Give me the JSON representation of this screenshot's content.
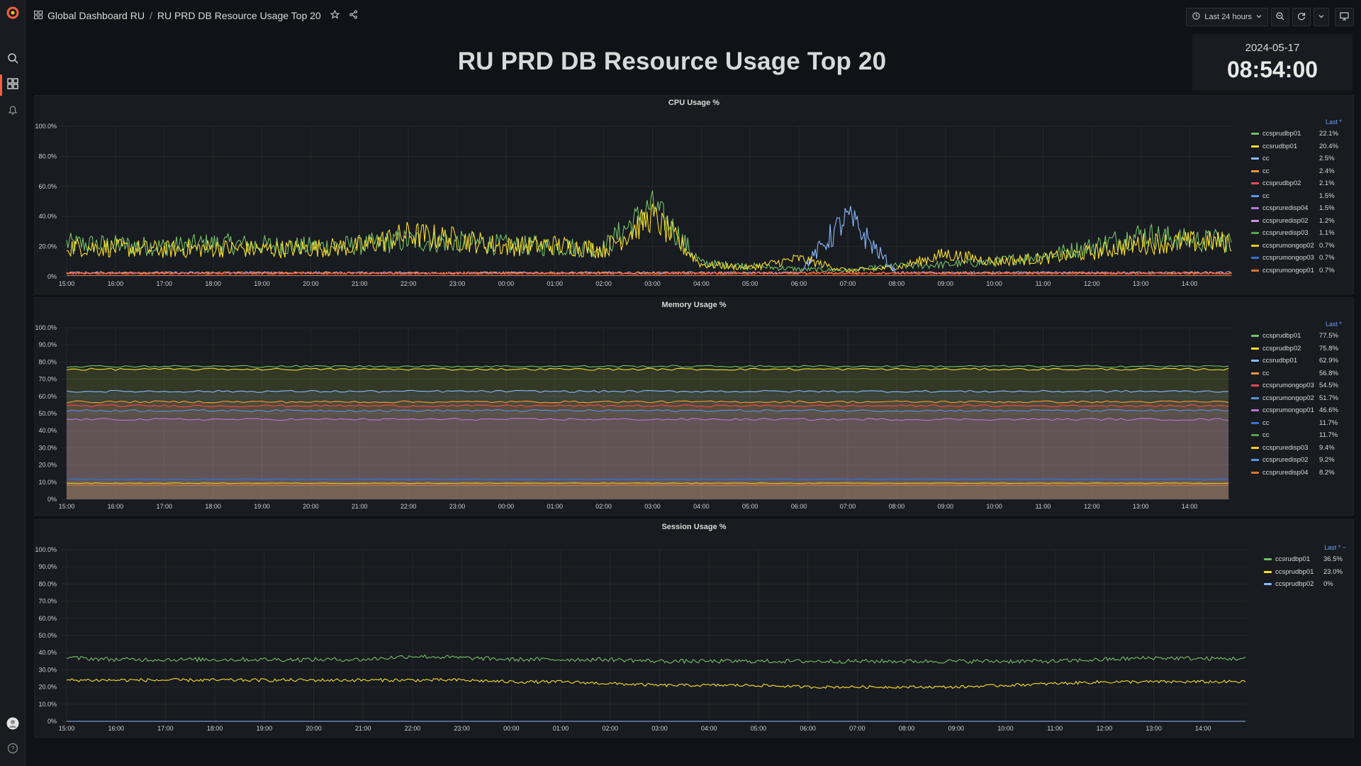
{
  "nav": {
    "breadcrumb_folder": "Global Dashboard RU",
    "breadcrumb_sep": "/",
    "breadcrumb_dashboard": "RU PRD DB Resource Usage Top 20"
  },
  "toolbar": {
    "time_range": "Last 24 hours"
  },
  "dashboard": {
    "title": "RU PRD DB Resource Usage Top 20",
    "clock_date": "2024-05-17",
    "clock_time": "08:54:00"
  },
  "colors": {
    "green": "#73bf69",
    "yellow": "#fade2a",
    "blue": "#8ab8ff",
    "orange": "#ff9830",
    "red": "#f2495c",
    "darkblue": "#5794f2",
    "purple": "#b877d9",
    "brand": "#f55f3e"
  },
  "x_ticks": [
    "15:00",
    "16:00",
    "17:00",
    "18:00",
    "19:00",
    "20:00",
    "21:00",
    "22:00",
    "23:00",
    "00:00",
    "01:00",
    "02:00",
    "03:00",
    "04:00",
    "05:00",
    "06:00",
    "07:00",
    "08:00",
    "09:00",
    "10:00",
    "11:00",
    "12:00",
    "13:00",
    "14:00"
  ],
  "panels": {
    "cpu": {
      "title": "CPU Usage %",
      "legend_header": "Last *",
      "y_ticks": [
        "100.0%",
        "80.0%",
        "60.0%",
        "40.0%",
        "20.0%",
        "0%"
      ],
      "legend": [
        {
          "name": "ccsprudbp01",
          "value": "22.1%",
          "color": "#73bf69"
        },
        {
          "name": "ccsrudbp01",
          "value": "20.4%",
          "color": "#fade2a"
        },
        {
          "name": "cc",
          "value": "2.5%",
          "color": "#8ab8ff"
        },
        {
          "name": "cc",
          "value": "2.4%",
          "color": "#ff9830"
        },
        {
          "name": "ccsprudbp02",
          "value": "2.1%",
          "color": "#f2495c"
        },
        {
          "name": "cc",
          "value": "1.5%",
          "color": "#5794f2"
        },
        {
          "name": "ccspruredisp04",
          "value": "1.5%",
          "color": "#b877d9"
        },
        {
          "name": "ccspruredisp02",
          "value": "1.2%",
          "color": "#ca95e5"
        },
        {
          "name": "ccspruredisp03",
          "value": "1.1%",
          "color": "#56a64b"
        },
        {
          "name": "ccsprumongop02",
          "value": "0.7%",
          "color": "#f2cc0c"
        },
        {
          "name": "ccsprumongop03",
          "value": "0.7%",
          "color": "#3274d9"
        },
        {
          "name": "ccsprumongop01",
          "value": "0.7%",
          "color": "#e0752d"
        }
      ]
    },
    "memory": {
      "title": "Memory Usage %",
      "legend_header": "Last *",
      "y_ticks": [
        "100.0%",
        "90.0%",
        "80.0%",
        "70.0%",
        "60.0%",
        "50.0%",
        "40.0%",
        "30.0%",
        "20.0%",
        "10.0%",
        "0%"
      ],
      "legend": [
        {
          "name": "ccsprudbp01",
          "value": "77.5%",
          "color": "#73bf69"
        },
        {
          "name": "ccsprudbp02",
          "value": "75.8%",
          "color": "#fade2a"
        },
        {
          "name": "ccsrudbp01",
          "value": "62.9%",
          "color": "#8ab8ff"
        },
        {
          "name": "cc",
          "value": "56.8%",
          "color": "#ff9830"
        },
        {
          "name": "ccsprumongop03",
          "value": "54.5%",
          "color": "#f2495c"
        },
        {
          "name": "ccsprumongop02",
          "value": "51.7%",
          "color": "#5794f2"
        },
        {
          "name": "ccsprumongop01",
          "value": "46.6%",
          "color": "#b877d9"
        },
        {
          "name": "cc",
          "value": "11.7%",
          "color": "#3274d9"
        },
        {
          "name": "cc",
          "value": "11.7%",
          "color": "#56a64b"
        },
        {
          "name": "ccspruredisp03",
          "value": "9.4%",
          "color": "#f2cc0c"
        },
        {
          "name": "ccspruredisp02",
          "value": "9.2%",
          "color": "#5794f2"
        },
        {
          "name": "ccspruredisp04",
          "value": "8.2%",
          "color": "#e0752d"
        }
      ]
    },
    "session": {
      "title": "Session Usage %",
      "legend_header": "Last * ~",
      "y_ticks": [
        "100.0%",
        "90.0%",
        "80.0%",
        "70.0%",
        "60.0%",
        "50.0%",
        "40.0%",
        "30.0%",
        "20.0%",
        "10.0%",
        "0%"
      ],
      "legend": [
        {
          "name": "ccsrudbp01",
          "value": "36.5%",
          "color": "#73bf69"
        },
        {
          "name": "ccsprudbp01",
          "value": "23.0%",
          "color": "#fade2a"
        },
        {
          "name": "ccsprudbp02",
          "value": "0%",
          "color": "#8ab8ff"
        }
      ]
    }
  },
  "chart_data": [
    {
      "type": "line",
      "title": "CPU Usage %",
      "x": [
        "15:00",
        "16:00",
        "17:00",
        "18:00",
        "19:00",
        "20:00",
        "21:00",
        "22:00",
        "23:00",
        "00:00",
        "01:00",
        "02:00",
        "03:00",
        "04:00",
        "05:00",
        "06:00",
        "07:00",
        "08:00",
        "09:00",
        "10:00",
        "11:00",
        "12:00",
        "13:00",
        "14:00"
      ],
      "ylim": [
        0,
        100
      ],
      "series": [
        {
          "name": "ccsprudbp01",
          "values": [
            22,
            21,
            20,
            22,
            21,
            20,
            21,
            24,
            23,
            21,
            20,
            19,
            48,
            9,
            7,
            5,
            4,
            7,
            8,
            10,
            14,
            20,
            28,
            24
          ]
        },
        {
          "name": "ccsrudbp01",
          "values": [
            20,
            19,
            18,
            19,
            18,
            19,
            20,
            28,
            25,
            20,
            21,
            18,
            40,
            8,
            6,
            12,
            4,
            6,
            15,
            10,
            12,
            16,
            22,
            23
          ]
        },
        {
          "name": "cc",
          "values": [
            2.5,
            2.5,
            2.5,
            2.5,
            2.5,
            2.5,
            2.5,
            2.5,
            2.5,
            2.5,
            2.5,
            2.5,
            2.5,
            2.5,
            2.5,
            2.5,
            40,
            2.5,
            2.5,
            2.5,
            2.5,
            2.5,
            2.5,
            2.5
          ]
        },
        {
          "name": "cc",
          "values": [
            2.4,
            2.4,
            2.4,
            2.4,
            2.4,
            2.4,
            2.4,
            2.4,
            2.4,
            2.4,
            2.4,
            2.4,
            2.4,
            2.4,
            2.4,
            2.4,
            2.4,
            2.4,
            2.4,
            2.4,
            2.4,
            2.4,
            2.4,
            2.4
          ]
        },
        {
          "name": "ccsprudbp02",
          "values": [
            2.1,
            2.1,
            2.1,
            2.1,
            2.1,
            2.1,
            2.1,
            2.1,
            2.1,
            2.1,
            2.1,
            2.1,
            2.1,
            2.1,
            2.1,
            2.1,
            2.1,
            2.1,
            2.1,
            2.1,
            2.1,
            2.1,
            2.1,
            2.1
          ]
        },
        {
          "name": "ccsprumongop01",
          "values": [
            0.7,
            0.7,
            0.7,
            0.7,
            0.7,
            0.7,
            0.7,
            0.7,
            0.7,
            0.7,
            0.7,
            0.7,
            0.7,
            0.7,
            0.7,
            0.7,
            0.7,
            0.7,
            0.7,
            0.7,
            0.7,
            0.7,
            0.7,
            0.7
          ]
        }
      ]
    },
    {
      "type": "area",
      "title": "Memory Usage %",
      "x": [
        "15:00",
        "16:00",
        "17:00",
        "18:00",
        "19:00",
        "20:00",
        "21:00",
        "22:00",
        "23:00",
        "00:00",
        "01:00",
        "02:00",
        "03:00",
        "04:00",
        "05:00",
        "06:00",
        "07:00",
        "08:00",
        "09:00",
        "10:00",
        "11:00",
        "12:00",
        "13:00",
        "14:00"
      ],
      "ylim": [
        0,
        100
      ],
      "series": [
        {
          "name": "ccsprudbp01",
          "values": [
            77.5,
            77.5,
            77.5,
            77.5,
            77.5,
            77.5,
            77.5,
            77.5,
            77.5,
            77.5,
            77.5,
            77.5,
            77.5,
            77.5,
            77.5,
            77.5,
            77.5,
            77.5,
            77.5,
            77.5,
            77.5,
            77.5,
            77.5,
            77.5
          ]
        },
        {
          "name": "ccsprudbp02",
          "values": [
            75.8,
            75.8,
            75.8,
            75.8,
            75.8,
            75.8,
            75.8,
            75.8,
            75.8,
            75.8,
            75.8,
            75.8,
            75.8,
            75.8,
            75.8,
            75.8,
            75.8,
            75.8,
            75.8,
            75.8,
            75.8,
            75.8,
            75.8,
            75.8
          ]
        },
        {
          "name": "ccsrudbp01",
          "values": [
            62.9,
            62.9,
            62.9,
            62.9,
            62.9,
            62.9,
            62.9,
            62.9,
            62.9,
            62.9,
            62.9,
            62.9,
            62.9,
            62.9,
            62.9,
            62.9,
            62.9,
            62.9,
            62.9,
            62.9,
            62.9,
            62.9,
            62.9,
            62.9
          ]
        },
        {
          "name": "cc",
          "values": [
            56.8,
            56.8,
            56.8,
            56.8,
            56.8,
            56.8,
            56.8,
            56.8,
            56.8,
            56.8,
            56.8,
            56.8,
            56.8,
            56.8,
            56.8,
            56.8,
            56.8,
            56.8,
            56.8,
            56.8,
            56.8,
            56.8,
            56.8,
            56.8
          ]
        },
        {
          "name": "ccsprumongop03",
          "values": [
            54.5,
            54.5,
            54.5,
            54.5,
            54.5,
            54.5,
            54.5,
            54.5,
            54.5,
            54.5,
            54.5,
            54.5,
            54.5,
            54.5,
            54.5,
            54.5,
            54.5,
            54.5,
            54.5,
            54.5,
            54.5,
            54.5,
            54.5,
            54.5
          ]
        },
        {
          "name": "ccsprumongop02",
          "values": [
            51.7,
            51.7,
            51.7,
            51.7,
            51.7,
            51.7,
            51.7,
            51.7,
            51.7,
            51.7,
            51.7,
            51.7,
            51.7,
            51.7,
            51.7,
            51.7,
            51.7,
            51.7,
            51.7,
            51.7,
            51.7,
            51.7,
            51.7,
            51.7
          ]
        },
        {
          "name": "ccsprumongop01",
          "values": [
            46.6,
            46.6,
            46.6,
            46.6,
            46.6,
            46.6,
            46.6,
            46.6,
            46.6,
            46.6,
            46.6,
            46.6,
            46.6,
            46.6,
            46.6,
            46.6,
            46.6,
            46.6,
            46.6,
            46.6,
            46.6,
            46.6,
            46.6,
            46.6
          ]
        },
        {
          "name": "cc",
          "values": [
            11.7,
            11.7,
            11.7,
            11.7,
            11.7,
            11.7,
            11.7,
            11.7,
            11.7,
            11.7,
            11.7,
            11.7,
            11.7,
            11.7,
            11.7,
            11.7,
            11.7,
            11.7,
            11.7,
            11.7,
            11.7,
            11.7,
            11.7,
            11.7
          ]
        },
        {
          "name": "ccspruredisp03",
          "values": [
            9.4,
            9.4,
            9.4,
            9.4,
            9.4,
            9.4,
            9.4,
            9.4,
            9.4,
            9.4,
            9.4,
            9.4,
            9.4,
            9.4,
            9.4,
            9.4,
            9.4,
            9.4,
            9.4,
            9.4,
            9.4,
            9.4,
            9.4,
            9.4
          ]
        },
        {
          "name": "ccspruredisp04",
          "values": [
            8.2,
            8.2,
            8.2,
            8.2,
            8.2,
            8.2,
            8.2,
            8.2,
            8.2,
            8.2,
            8.2,
            8.2,
            8.2,
            8.2,
            8.2,
            8.2,
            8.2,
            8.2,
            8.2,
            8.2,
            8.2,
            8.2,
            8.2,
            8.2
          ]
        }
      ]
    },
    {
      "type": "line",
      "title": "Session Usage %",
      "x": [
        "15:00",
        "16:00",
        "17:00",
        "18:00",
        "19:00",
        "20:00",
        "21:00",
        "22:00",
        "23:00",
        "00:00",
        "01:00",
        "02:00",
        "03:00",
        "04:00",
        "05:00",
        "06:00",
        "07:00",
        "08:00",
        "09:00",
        "10:00",
        "11:00",
        "12:00",
        "13:00",
        "14:00"
      ],
      "ylim": [
        0,
        100
      ],
      "series": [
        {
          "name": "ccsrudbp01",
          "values": [
            37,
            36,
            36,
            36,
            36,
            36,
            36,
            38,
            37,
            36,
            36,
            36,
            35,
            35,
            35,
            35,
            35,
            35,
            35,
            35,
            35,
            36,
            37,
            36.5
          ]
        },
        {
          "name": "ccsprudbp01",
          "values": [
            24,
            24,
            24,
            24,
            24,
            24,
            24,
            24,
            24,
            23,
            23,
            22,
            21,
            21,
            21,
            20,
            20,
            20,
            20,
            21,
            22,
            23,
            23,
            23
          ]
        },
        {
          "name": "ccsprudbp02",
          "values": [
            0,
            0,
            0,
            0,
            0,
            0,
            0,
            0,
            0,
            0,
            0,
            0,
            0,
            0,
            0,
            0,
            0,
            0,
            0,
            0,
            0,
            0,
            0,
            0
          ]
        }
      ]
    }
  ]
}
